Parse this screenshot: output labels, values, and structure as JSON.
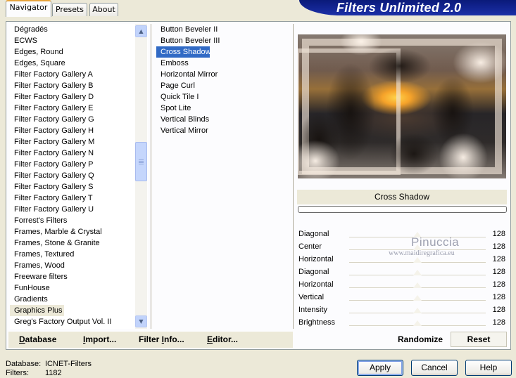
{
  "header": {
    "title": "Filters Unlimited 2.0"
  },
  "tabs": [
    {
      "label": "Navigator",
      "active": true
    },
    {
      "label": "Presets",
      "active": false
    },
    {
      "label": "About",
      "active": false
    }
  ],
  "categories": {
    "items": [
      "Dégradés",
      "ECWS",
      "Edges, Round",
      "Edges, Square",
      "Filter Factory Gallery A",
      "Filter Factory Gallery B",
      "Filter Factory Gallery D",
      "Filter Factory Gallery E",
      "Filter Factory Gallery G",
      "Filter Factory Gallery H",
      "Filter Factory Gallery M",
      "Filter Factory Gallery N",
      "Filter Factory Gallery P",
      "Filter Factory Gallery Q",
      "Filter Factory Gallery S",
      "Filter Factory Gallery T",
      "Filter Factory Gallery U",
      "Forrest's Filters",
      "Frames, Marble & Crystal",
      "Frames, Stone & Granite",
      "Frames, Textured",
      "Frames, Wood",
      "Freeware filters",
      "FunHouse",
      "Gradients",
      "Graphics Plus",
      "Greg's Factory Output Vol. II"
    ],
    "highlighted": "Graphics Plus"
  },
  "filters": {
    "items": [
      "Button Beveler II",
      "Button Beveler III",
      "Cross Shadow",
      "Emboss",
      "Horizontal Mirror",
      "Page Curl",
      "Quick Tile I",
      "Spot Lite",
      "Vertical Blinds",
      "Vertical Mirror"
    ],
    "selected": "Cross Shadow"
  },
  "preview": {
    "filter_name": "Cross Shadow",
    "progress": 0
  },
  "watermark": {
    "name": "Pinuccia",
    "url": "www.maidiregrafica.eu"
  },
  "parameters": [
    {
      "label": "Diagonal",
      "value": "128"
    },
    {
      "label": "Center",
      "value": "128"
    },
    {
      "label": "Horizontal",
      "value": "128"
    },
    {
      "label": "Diagonal",
      "value": "128"
    },
    {
      "label": "Horizontal",
      "value": "128"
    },
    {
      "label": "Vertical",
      "value": "128"
    },
    {
      "label": "Intensity",
      "value": "128"
    },
    {
      "label": "Brightness",
      "value": "128"
    }
  ],
  "toolbar": {
    "database": {
      "key": "D",
      "rest": "atabase"
    },
    "import": {
      "key": "I",
      "rest": "mport..."
    },
    "filter_info": {
      "pre": "Filter ",
      "key": "I",
      "rest": "nfo..."
    },
    "editor": {
      "key": "E",
      "rest": "ditor..."
    },
    "randomize": "Randomize",
    "reset": "Reset"
  },
  "footer": {
    "database_label": "Database:",
    "database_value": "ICNET-Filters",
    "filters_label": "Filters:",
    "filters_value": "1182"
  },
  "dialog_buttons": {
    "apply": "Apply",
    "cancel": "Cancel",
    "help": "Help"
  }
}
